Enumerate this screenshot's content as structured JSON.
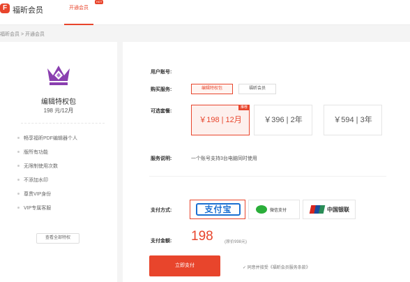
{
  "header": {
    "logo_letter": "F",
    "brand": "福昕会员",
    "tab": "开通会员",
    "hot": "HOT"
  },
  "breadcrumb": "福昕会员 > 开通会员",
  "package": {
    "title": "编辑特权包",
    "price": "198 元/12月",
    "features": [
      "畅享福昕PDF编辑器个人",
      "版所有功能",
      "无限制使用次数",
      "不添加水印",
      "尊贵VIP身份",
      "VIP专属客服"
    ],
    "view_all": "查看全部特权"
  },
  "form": {
    "account_label": "用户账号:",
    "service_label": "购买服务:",
    "services": [
      "编辑特权包",
      "福昕会员"
    ],
    "plan_label": "可选套餐:",
    "plans": [
      "￥198 | 12月",
      "￥396 | 2年",
      "￥594 | 3年"
    ],
    "recommend_badge": "推荐",
    "desc_label": "服务说明:",
    "desc_text": "一个账号支持3台电脑同时使用",
    "pay_label": "支付方式:",
    "pay_alipay": "支付宝",
    "pay_wechat": "微信支付",
    "pay_unionpay": "中国银联",
    "amount_label": "支付金额:",
    "amount": "198",
    "original_price": "(原价998元)",
    "submit": "立即支付",
    "agreement": "✓ 同意并接受《福昕会员服务条款》"
  },
  "colors": {
    "accent": "#e8452c",
    "alipay": "#1a6fd1",
    "wechat": "#2aae3a"
  }
}
